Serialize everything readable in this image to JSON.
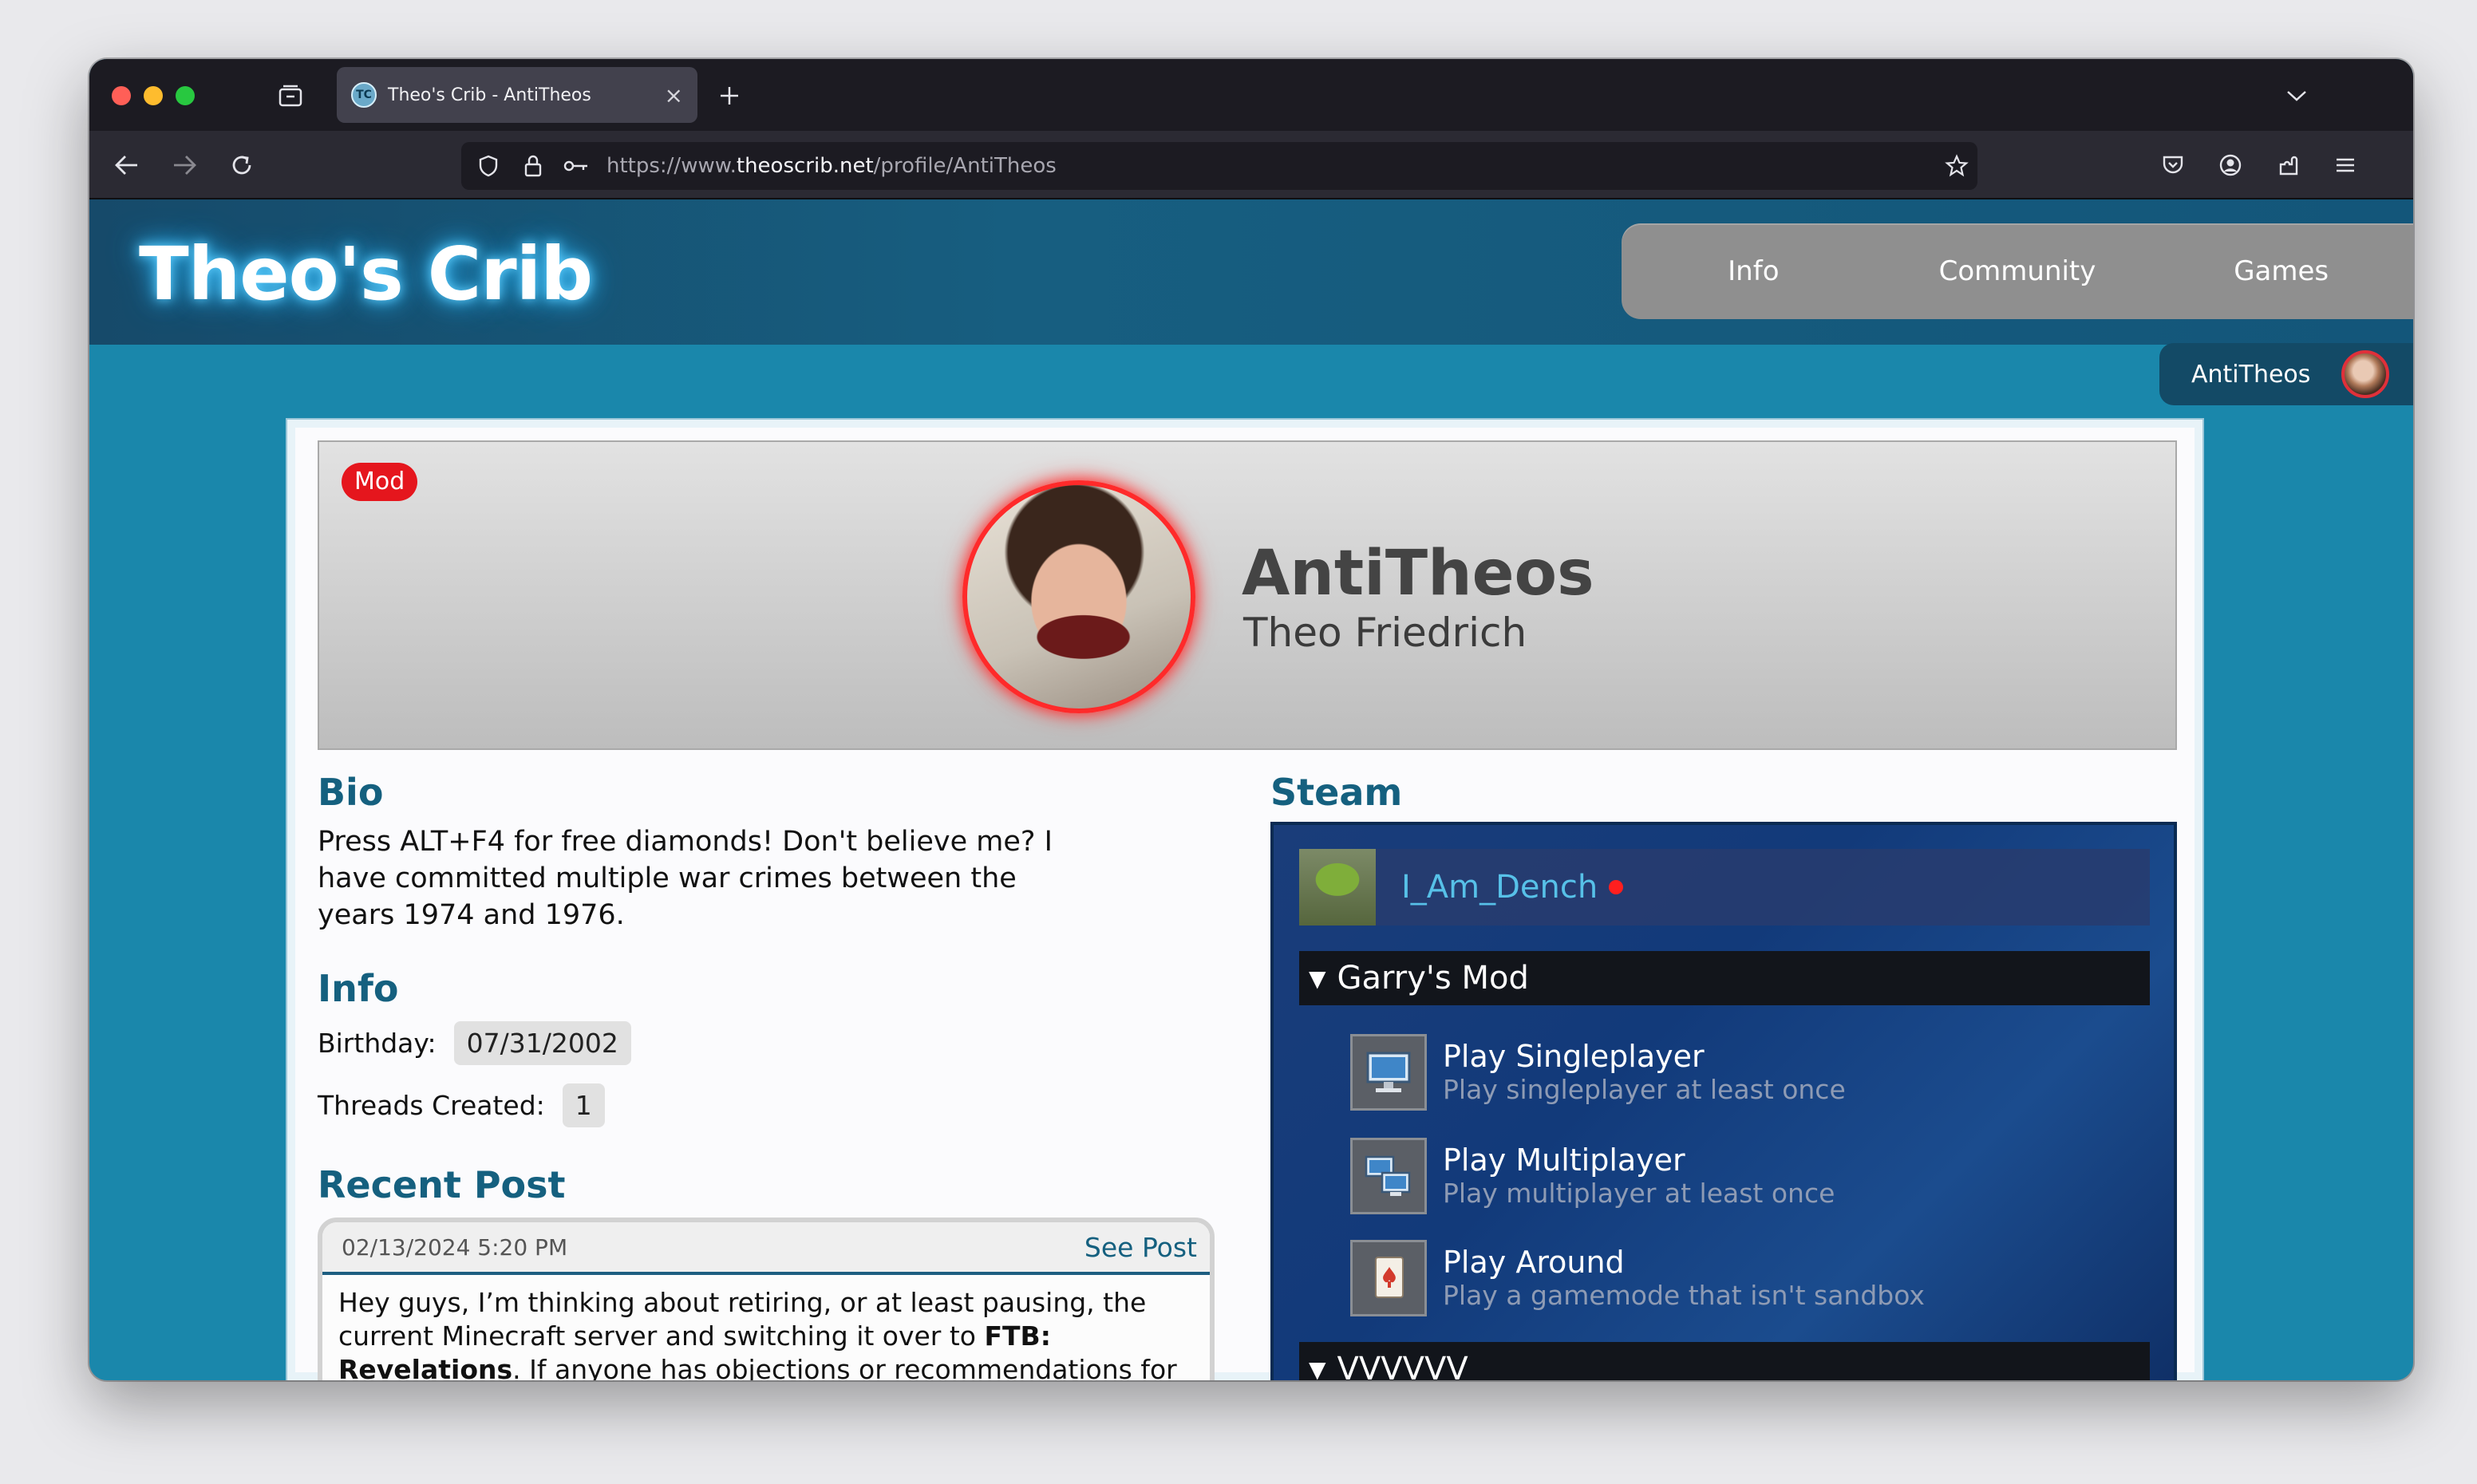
{
  "browser": {
    "tab_title": "Theo's Crib - AntiTheos",
    "tab_favicon_text": "TC",
    "url_prefix": "https://www.",
    "url_host": "theoscrib.net",
    "url_path": "/profile/AntiTheos"
  },
  "site": {
    "logo": "Theo's Crib",
    "nav": [
      "Info",
      "Community",
      "Games"
    ],
    "current_user": "AntiTheos"
  },
  "profile": {
    "badge": "Mod",
    "username": "AntiTheos",
    "real_name": "Theo Friedrich"
  },
  "bio": {
    "title": "Bio",
    "text": "Press ALT+F4 for free diamonds! Don't believe me? I have committed multiple war crimes between the years 1974 and 1976."
  },
  "info": {
    "title": "Info",
    "birthday_label": "Birthday:",
    "birthday_value": "07/31/2002",
    "threads_label": "Threads Created:",
    "threads_value": "1"
  },
  "recent_post": {
    "title": "Recent Post",
    "date": "02/13/2024 5:20 PM",
    "link": "See Post",
    "text_1": "Hey guys, I’m thinking about retiring, or at least pausing, the current Minecraft server and switching it over to ",
    "text_bold": "FTB: Revelations",
    "text_2": ". If anyone has objections or recommendations for different mod"
  },
  "steam": {
    "title": "Steam",
    "username": "I_Am_Dench",
    "status_color": "#ff1f1f",
    "games": [
      {
        "name": "Garry's Mod",
        "achievements": [
          {
            "name": "Play Singleplayer",
            "desc": "Play singleplayer at least once",
            "icon": "monitor-icon"
          },
          {
            "name": "Play Multiplayer",
            "desc": "Play multiplayer at least once",
            "icon": "network-icon"
          },
          {
            "name": "Play Around",
            "desc": "Play a gamemode that isn't sandbox",
            "icon": "playing-card-icon"
          }
        ]
      },
      {
        "name": "VVVVVV"
      }
    ]
  },
  "colors": {
    "page_bg": "#1a87ab",
    "header_bg": "#164a6a",
    "accent": "#15607f",
    "mod_badge": "#e5161d"
  }
}
